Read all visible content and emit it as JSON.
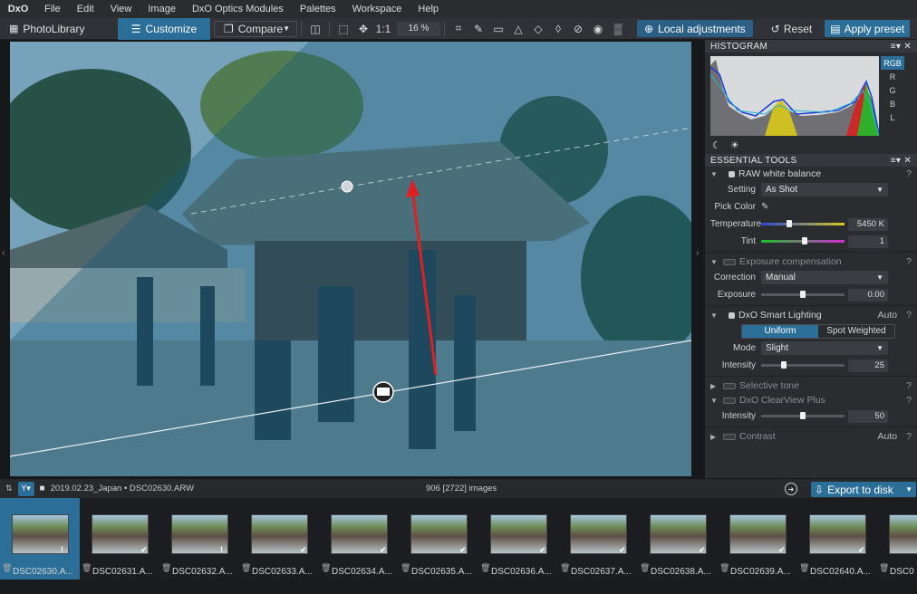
{
  "menu": {
    "logo": "DxO",
    "items": [
      "File",
      "Edit",
      "View",
      "Image",
      "DxO Optics Modules",
      "Palettes",
      "Workspace",
      "Help"
    ]
  },
  "toolbar": {
    "photolibrary": "PhotoLibrary",
    "customize": "Customize",
    "compare": "Compare",
    "zoom_1to1": "1:1",
    "zoom_value": "16 %",
    "local_adjustments": "Local adjustments",
    "reset": "Reset",
    "apply_preset": "Apply preset"
  },
  "histogram": {
    "title": "HISTOGRAM",
    "channels": [
      "RGB",
      "R",
      "G",
      "B",
      "L"
    ],
    "active_channel": "RGB"
  },
  "essential_tools": {
    "title": "ESSENTIAL TOOLS",
    "raw_white_balance": {
      "title": "RAW white balance",
      "setting_label": "Setting",
      "setting_value": "As Shot",
      "pick_color_label": "Pick Color",
      "temperature_label": "Temperature",
      "temperature_value": "5450 K",
      "tint_label": "Tint",
      "tint_value": "1"
    },
    "exposure_compensation": {
      "title": "Exposure compensation",
      "correction_label": "Correction",
      "correction_value": "Manual",
      "exposure_label": "Exposure",
      "exposure_value": "0.00"
    },
    "smart_lighting": {
      "title": "DxO Smart Lighting",
      "auto": "Auto",
      "mode_uniform": "Uniform",
      "mode_spot": "Spot Weighted",
      "mode_label": "Mode",
      "mode_value": "Slight",
      "intensity_label": "Intensity",
      "intensity_value": "25"
    },
    "selective_tone": {
      "title": "Selective tone"
    },
    "clearview": {
      "title": "DxO ClearView Plus",
      "intensity_label": "Intensity",
      "intensity_value": "50"
    },
    "contrast": {
      "title": "Contrast",
      "auto": "Auto"
    }
  },
  "strip": {
    "folder_path": "2019.02.23_Japan • DSC02630.ARW",
    "image_count": "906 [2722] images",
    "export": "Export to disk"
  },
  "thumbnails": [
    {
      "name": "DSC02630.A...",
      "badge": "!"
    },
    {
      "name": "DSC02631.A...",
      "badge": "✔"
    },
    {
      "name": "DSC02632.A...",
      "badge": "!"
    },
    {
      "name": "DSC02633.A...",
      "badge": "✔"
    },
    {
      "name": "DSC02634.A...",
      "badge": "✔"
    },
    {
      "name": "DSC02635.A...",
      "badge": "✔"
    },
    {
      "name": "DSC02636.A...",
      "badge": "✔"
    },
    {
      "name": "DSC02637.A...",
      "badge": "✔"
    },
    {
      "name": "DSC02638.A...",
      "badge": "✔"
    },
    {
      "name": "DSC02639.A...",
      "badge": "✔"
    },
    {
      "name": "DSC02640.A...",
      "badge": "✔"
    },
    {
      "name": "DSC0",
      "badge": ""
    }
  ],
  "colors": {
    "accent": "#2b6e98",
    "panel_bg": "#2a2c30",
    "menubar_bg": "#2a2c30"
  },
  "slider_levels": {
    "temperature": 0.32,
    "tint": 0.52,
    "exposure": 0.5,
    "smart_lighting_intensity": 0.25,
    "clearview_intensity": 0.5
  }
}
